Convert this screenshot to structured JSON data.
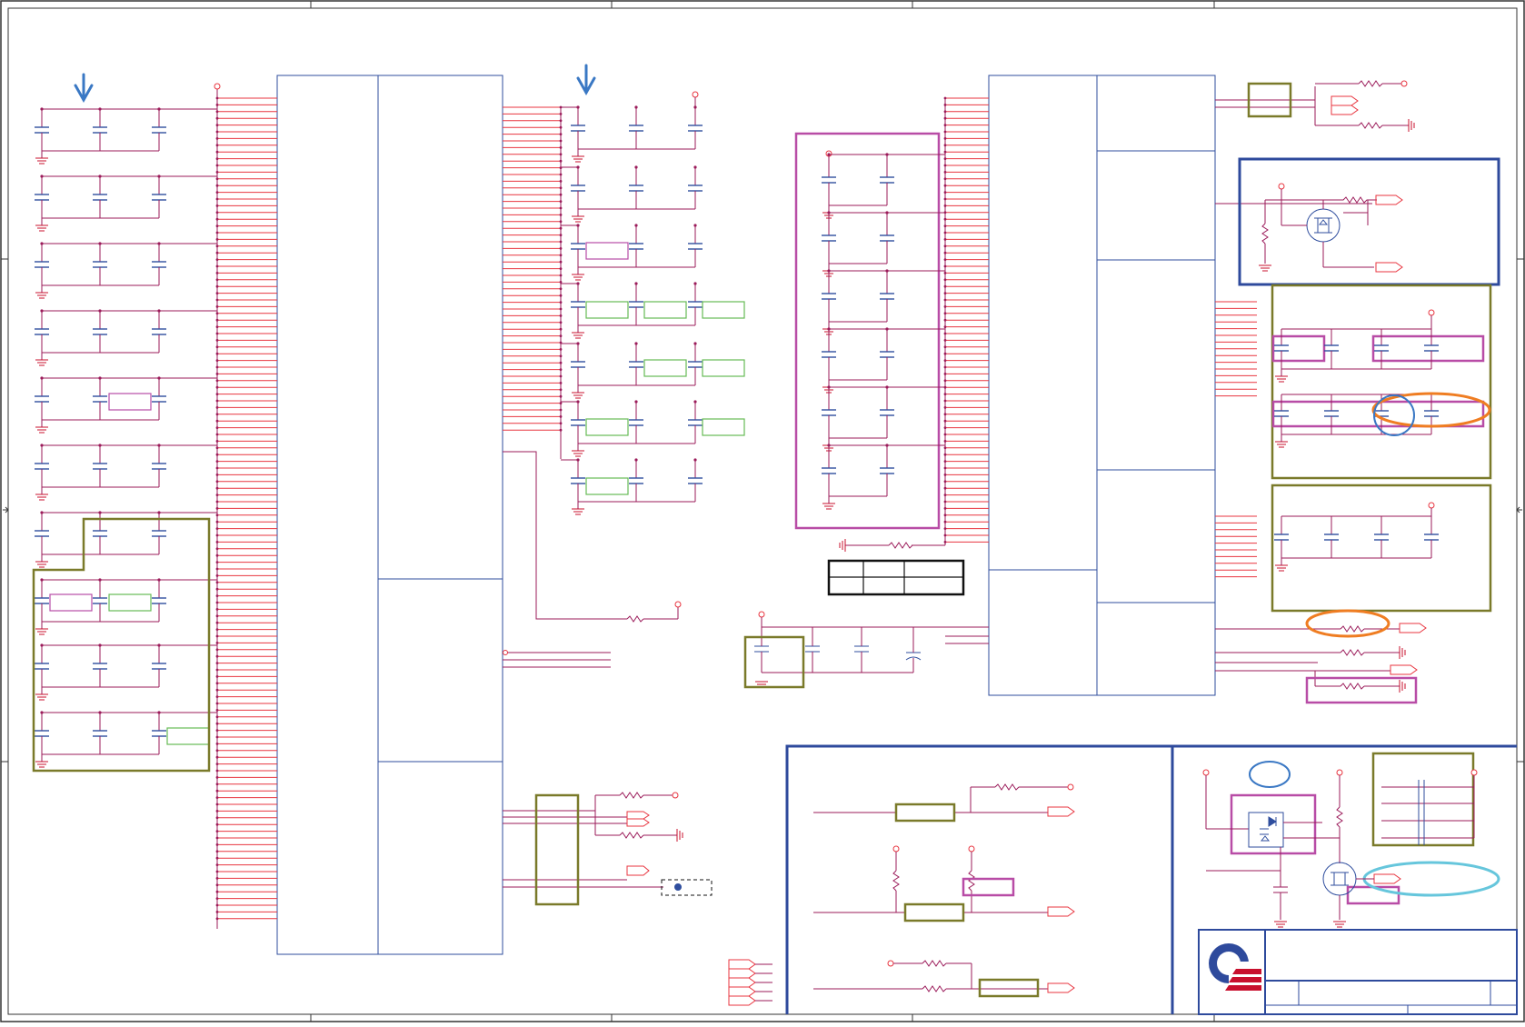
{
  "sheet": {
    "title": "",
    "colors": {
      "frame": "#333333",
      "wire": "#e8343f",
      "net": "#9b1b5a",
      "part": "#2f4e9e",
      "gnd": "#c8102e",
      "highlight_olive": "#7a7a2a",
      "highlight_magenta": "#b84ca6",
      "highlight_navy": "#2e4a9c",
      "highlight_orange": "#ef7d22",
      "highlight_cyan": "#66c6dc",
      "highlight_green": "#66bb55",
      "marker_arrow": "#3a78c4"
    }
  },
  "symbols": {
    "cap": "capacitor-icon",
    "res": "resistor-icon",
    "gnd": "ground-icon",
    "mosfet": "mosfet-icon",
    "port": "port-icon",
    "logo": "company-logo"
  }
}
